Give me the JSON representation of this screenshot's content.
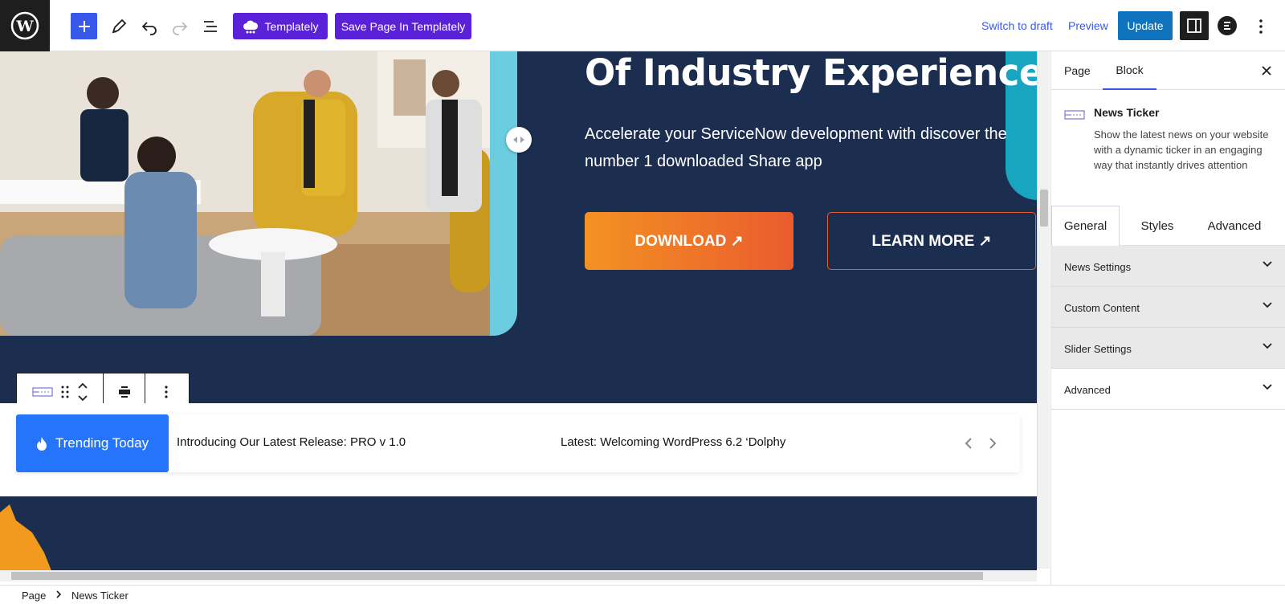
{
  "toolbar": {
    "templately_label": "Templately",
    "save_templately_label": "Save Page In Templately",
    "switch_draft_label": "Switch to draft",
    "preview_label": "Preview",
    "update_label": "Update"
  },
  "hero": {
    "title": "Of Industry Experience",
    "subtitle": "Accelerate your ServiceNow development with discover the number 1 downloaded Share app",
    "download_label": "DOWNLOAD ↗",
    "learn_more_label": "LEARN MORE ↗"
  },
  "ticker": {
    "label": "Trending Today",
    "items": [
      "Introducing Our Latest Release: PRO v 1.0",
      "Latest: Welcoming WordPress 6.2 ‘Dolphy"
    ]
  },
  "sidebar": {
    "tabs": [
      "Page",
      "Block"
    ],
    "active_tab": "Block",
    "block_title": "News Ticker",
    "block_description": "Show the latest news on your website with a dynamic ticker in an engaging way that instantly drives attention",
    "control_tabs": [
      "General",
      "Styles",
      "Advanced"
    ],
    "panels": [
      "News Settings",
      "Custom Content",
      "Slider Settings",
      "Advanced"
    ]
  },
  "breadcrumb": {
    "root": "Page",
    "current": "News Ticker"
  },
  "colors": {
    "wp_accent": "#3858e9",
    "templately_purple": "#5b21d9",
    "hero_navy": "#1c2e50",
    "teal": "#6dcde0",
    "ticker_blue": "#2575fc",
    "download_orange": "#f39223"
  }
}
